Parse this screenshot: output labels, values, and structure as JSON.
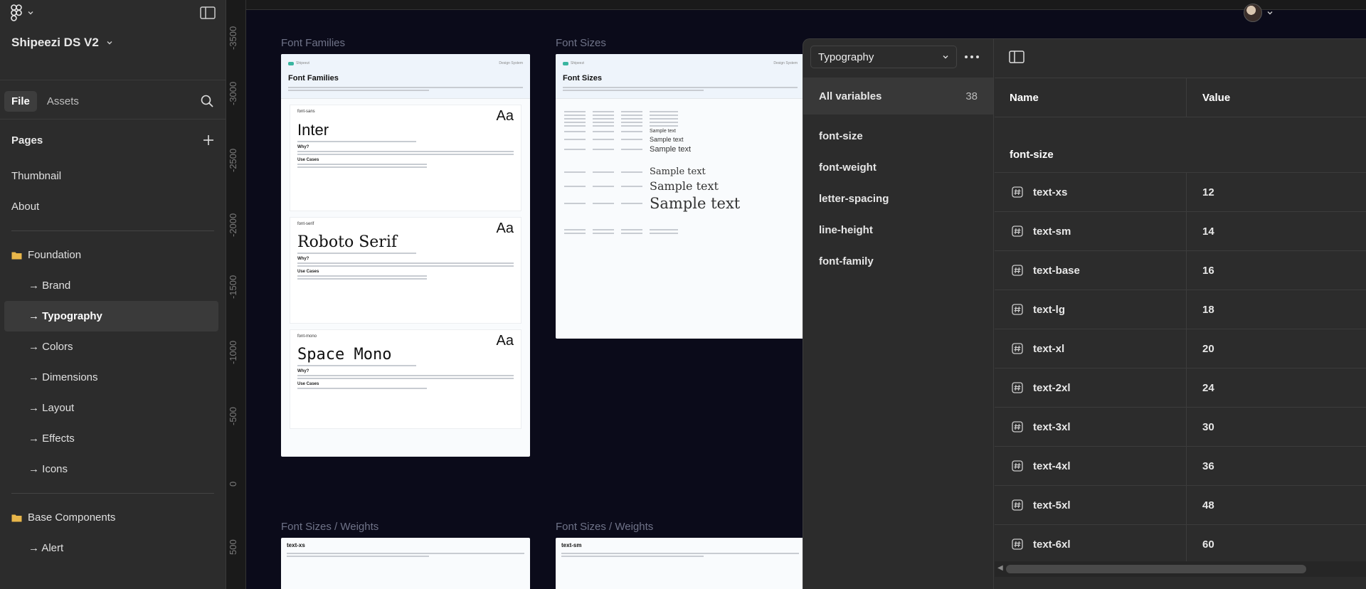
{
  "sidebar": {
    "project_name": "Shipeezi DS V2",
    "tabs": [
      "File",
      "Assets"
    ],
    "pages_label": "Pages",
    "pages": [
      {
        "label": "Thumbnail"
      },
      {
        "label": "About"
      }
    ],
    "foundation": {
      "label": "Foundation",
      "items": [
        "→ Brand",
        "→ Typography",
        "→ Colors",
        "→ Dimensions",
        "→ Layout",
        "→ Effects",
        "→ Icons"
      ],
      "selected_index": 1
    },
    "base_components": {
      "label": "Base Components",
      "items": [
        "→ Alert"
      ]
    }
  },
  "canvas": {
    "ruler_ticks": [
      "-3500",
      "-3000",
      "-2500",
      "-2000",
      "-1500",
      "-1000",
      "-500",
      "0",
      "500"
    ],
    "frames": [
      {
        "label": "Font Families",
        "title": "Font Families",
        "cards": [
          {
            "tag": "font-sans",
            "aa": "Aa",
            "name": "Inter",
            "why": "Why?",
            "use": "Use Cases"
          },
          {
            "tag": "font-serif",
            "aa": "Aa",
            "name": "Roboto Serif",
            "why": "Why?",
            "use": "Use Cases"
          },
          {
            "tag": "font-mono",
            "aa": "Aa",
            "name": "Space Mono",
            "why": "Why?",
            "use": "Use Cases"
          }
        ]
      },
      {
        "label": "Font Sizes",
        "title": "Font Sizes",
        "samples": [
          "Sample text",
          "Sample text",
          "Sample text",
          "Sample text",
          "Sample text",
          "Sample text"
        ]
      }
    ],
    "bottom_labels": [
      "Font Sizes / Weights",
      "Font Sizes / Weights"
    ],
    "bottom_titles": [
      "text-xs",
      "text-sm"
    ]
  },
  "variables_panel": {
    "collection": "Typography",
    "all_variables_label": "All variables",
    "all_variables_count": "38",
    "groups": [
      "font-size",
      "font-weight",
      "letter-spacing",
      "line-height",
      "font-family"
    ],
    "columns": {
      "name": "Name",
      "value": "Value"
    },
    "current_group": "font-size",
    "rows": [
      {
        "name": "text-xs",
        "value": "12"
      },
      {
        "name": "text-sm",
        "value": "14"
      },
      {
        "name": "text-base",
        "value": "16"
      },
      {
        "name": "text-lg",
        "value": "18"
      },
      {
        "name": "text-xl",
        "value": "20"
      },
      {
        "name": "text-2xl",
        "value": "24"
      },
      {
        "name": "text-3xl",
        "value": "30"
      },
      {
        "name": "text-4xl",
        "value": "36"
      },
      {
        "name": "text-5xl",
        "value": "48"
      },
      {
        "name": "text-6xl",
        "value": "60"
      }
    ]
  },
  "icons": {
    "logo": "figma-logo-icon",
    "layout_toggle": "sidebar-toggle-icon",
    "search": "search-icon",
    "add_page": "plus-icon",
    "folder": "folder-icon",
    "variable": "number-variable-icon",
    "more": "more-options-icon",
    "chevron": "chevron-down-icon"
  },
  "colors": {
    "accent_teal": "#39b5a0",
    "folder_yellow": "#e8b64a",
    "canvas_bg": "#0b0b1a"
  }
}
